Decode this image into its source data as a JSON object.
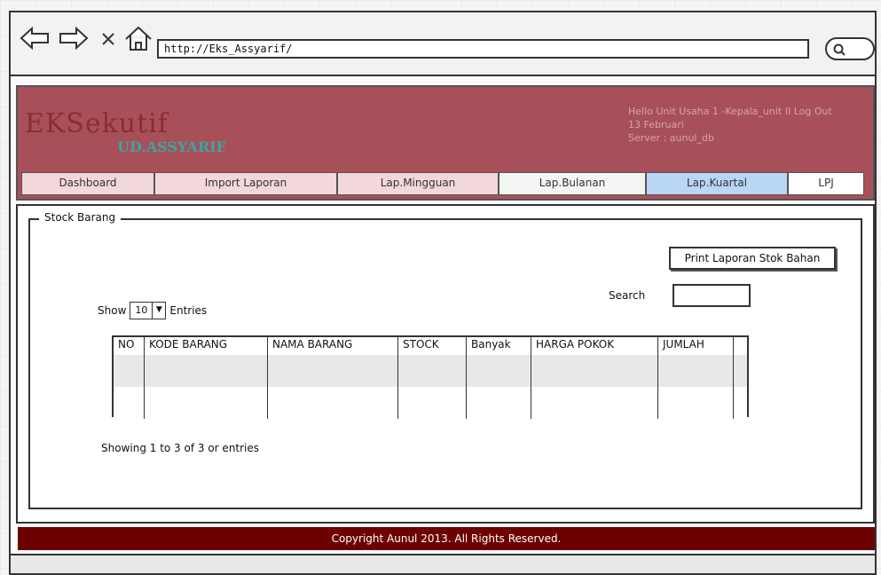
{
  "browser": {
    "url": "http://Eks_Assyarif/",
    "icons": [
      "back-arrow-icon",
      "forward-arrow-icon",
      "stop-icon",
      "home-icon",
      "search-icon"
    ]
  },
  "header": {
    "brand": "EKSekutif",
    "sub_brand": "UD.ASSYARIF",
    "user_line": "Hello Unit Usaha 1 -Kepala_unit II Log Out",
    "date_line": "13 Februari",
    "server_line": "Server : aunul_db"
  },
  "menu": [
    {
      "label": "Dashboard",
      "color": "#f2d7db"
    },
    {
      "label": "Import Laporan",
      "color": "#f2d7db"
    },
    {
      "label": "Lap.Mingguan",
      "color": "#f2d7db"
    },
    {
      "label": "Lap.Bulanan",
      "color": "#f3f5f3"
    },
    {
      "label": "Lap.Kuartal",
      "color": "#b9d6f7"
    },
    {
      "label": "LPJ",
      "color": "#ffffff"
    }
  ],
  "stock": {
    "legend": "Stock Barang",
    "print_button": "Print Laporan Stok Bahan",
    "search_label": "Search",
    "show_label": "Show",
    "entries_value": "10",
    "entries_label": "Entries",
    "columns": [
      "NO",
      "KODE BARANG",
      "NAMA BARANG",
      "STOCK",
      "Banyak",
      "HARGA POKOK",
      "JUMLAH",
      ""
    ],
    "info": "Showing 1 to 3 of 3 or entries"
  },
  "footer": {
    "copyright": "Copyright Aunul 2013. All Rights Reserved."
  },
  "colors": {
    "header_bg": "#a8505a",
    "footer_bg": "#6d0000",
    "brand_sub": "#3aa6a0"
  }
}
